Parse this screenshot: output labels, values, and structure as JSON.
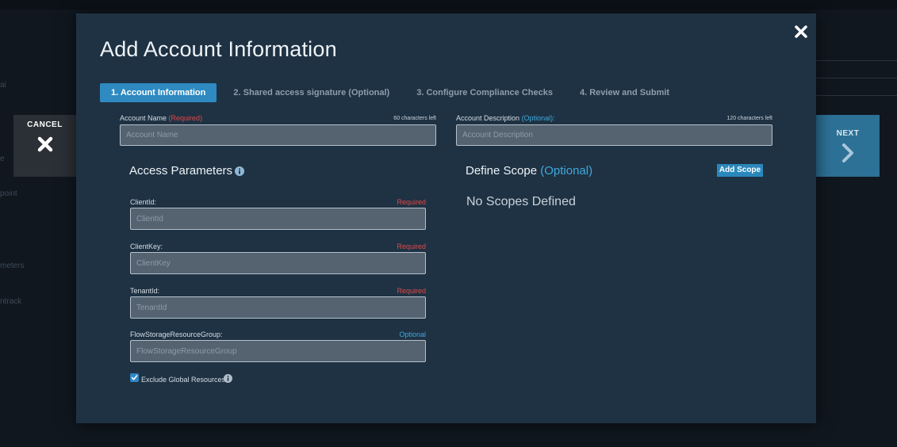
{
  "background": {
    "fragments": [
      "ai",
      "e",
      "point",
      "meters",
      "ntrack"
    ]
  },
  "side_buttons": {
    "cancel_label": "CANCEL",
    "next_label": "NEXT"
  },
  "modal": {
    "title": "Add Account Information",
    "close_icon": "close-icon"
  },
  "steps": [
    {
      "label": "1. Account Information",
      "active": true
    },
    {
      "label": "2. Shared access signature (Optional)",
      "active": false
    },
    {
      "label": "3. Configure Compliance Checks",
      "active": false
    },
    {
      "label": "4. Review and Submit",
      "active": false
    }
  ],
  "account_name": {
    "label": "Account Name",
    "qualifier": "(Required)",
    "chars_left": "60 characters left",
    "placeholder": "Account Name",
    "value": ""
  },
  "account_description": {
    "label": "Account Description",
    "qualifier": "(Optional):",
    "chars_left": "120 characters left",
    "placeholder": "Account Description",
    "value": ""
  },
  "access_parameters": {
    "title": "Access Parameters",
    "info_icon": "info-icon",
    "fields": [
      {
        "label": "ClientId:",
        "tag": "Required",
        "placeholder": "ClientId"
      },
      {
        "label": "ClientKey:",
        "tag": "Required",
        "placeholder": "ClientKey"
      },
      {
        "label": "TenantId:",
        "tag": "Required",
        "placeholder": "TenantId"
      },
      {
        "label": "FlowStorageResourceGroup:",
        "tag": "Optional",
        "placeholder": "FlowStorageResourceGroup"
      }
    ],
    "exclude_global": {
      "label": "Exclude Global Resources",
      "checked": true
    }
  },
  "scope": {
    "title": "Define Scope",
    "title_qualifier": "(Optional)",
    "add_button": "Add Scope",
    "empty_message": "No Scopes Defined"
  },
  "colors": {
    "modal_bg": "#1f3243",
    "accent": "#2e8ac0",
    "required": "#e04848",
    "optional": "#3fa9dd",
    "next_bg": "#2d7196",
    "cancel_bg": "#2b3036"
  }
}
